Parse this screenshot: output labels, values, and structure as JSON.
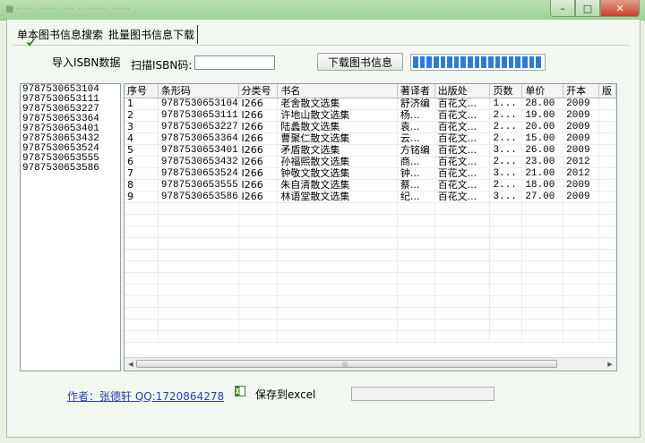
{
  "window": {
    "title_blur": "■·· ··· ···· ···· ·· ····· ·····",
    "min": "–",
    "max": "□",
    "close": "✕"
  },
  "tabs": [
    {
      "label": "单本图书信息搜索"
    },
    {
      "label": "批量图书信息下载"
    }
  ],
  "toolbar": {
    "import_label": "导入ISBN数据",
    "scan_label": "扫描ISBN码:",
    "scan_value": "",
    "download_label": "下载图书信息",
    "progress_segments": 19
  },
  "isbn_list": [
    "9787530653104",
    "9787530653111",
    "9787530653227",
    "9787530653364",
    "9787530653401",
    "9787530653432",
    "9787530653524",
    "9787530653555",
    "9787530653586"
  ],
  "grid": {
    "columns": [
      "序号",
      "条形码",
      "分类号",
      "书名",
      "著译者",
      "出版处",
      "页数",
      "单价",
      "开本",
      "版"
    ],
    "rows": [
      [
        "1",
        "9787530653104",
        "I266",
        "老舍散文选集",
        "舒济编",
        "百花文...",
        "1...",
        "28.00",
        "2009",
        ""
      ],
      [
        "2",
        "9787530653111",
        "I266",
        "许地山散文选集",
        "杨...",
        "百花文...",
        "2...",
        "19.00",
        "2009",
        ""
      ],
      [
        "3",
        "9787530653227",
        "I266",
        "陆蠡散文选集",
        "袁...",
        "百花文...",
        "2...",
        "20.00",
        "2009",
        ""
      ],
      [
        "4",
        "9787530653364",
        "I266",
        "曹聚仁散文选集",
        "云...",
        "百花文...",
        "2...",
        "15.00",
        "2009",
        ""
      ],
      [
        "5",
        "9787530653401",
        "I266",
        "矛盾散文选集",
        "方铭编",
        "百花文...",
        "3...",
        "26.00",
        "2009",
        ""
      ],
      [
        "6",
        "9787530653432",
        "I266",
        "孙福熙散文选集",
        "商...",
        "百花文...",
        "2...",
        "23.00",
        "2012",
        ""
      ],
      [
        "7",
        "9787530653524",
        "I266",
        "钟敬文散文选集",
        "钟...",
        "百花文...",
        "3...",
        "21.00",
        "2012",
        ""
      ],
      [
        "8",
        "9787530653555",
        "I266",
        "朱自清散文选集",
        "蔡...",
        "百花文...",
        "2...",
        "18.00",
        "2009",
        ""
      ],
      [
        "9",
        "9787530653586",
        "I266",
        "林语堂散文选集",
        "纪...",
        "百花文...",
        "3...",
        "27.00",
        "2009",
        ""
      ]
    ]
  },
  "footer": {
    "author": "作者：张德轩 QQ:1720864278",
    "save_label": "保存到excel",
    "save_value": ""
  },
  "colors": {
    "accent": "#2e7bd6",
    "link": "#2b3fb0",
    "title_bar": "#a6d69d"
  }
}
